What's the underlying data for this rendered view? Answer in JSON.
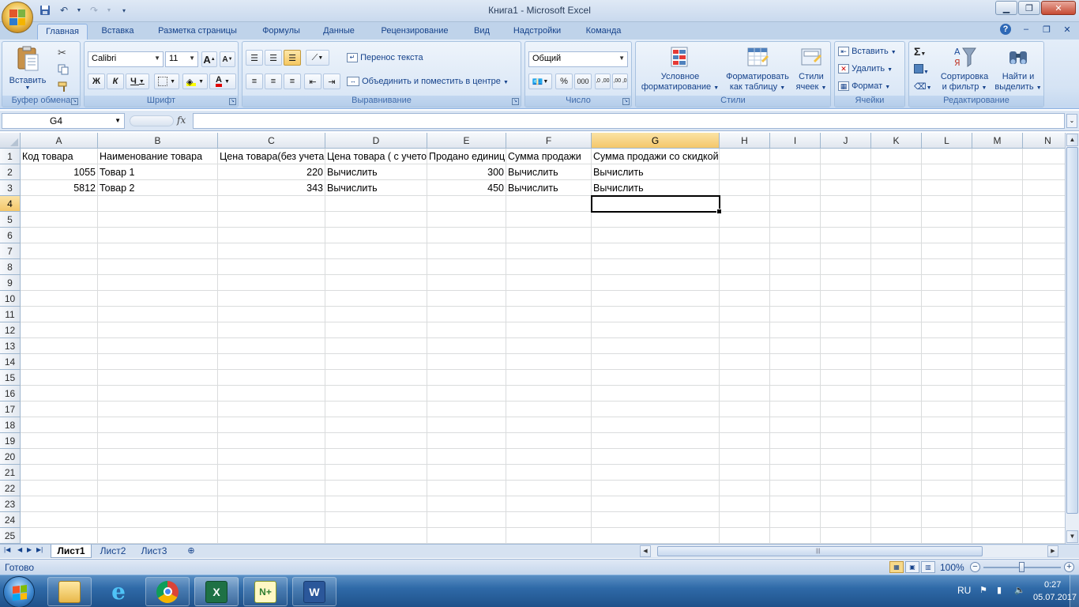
{
  "window": {
    "title": "Книга1 - Microsoft Excel"
  },
  "tabs": [
    "Главная",
    "Вставка",
    "Разметка страницы",
    "Формулы",
    "Данные",
    "Рецензирование",
    "Вид",
    "Надстройки",
    "Команда"
  ],
  "ribbon": {
    "clipboard": {
      "label": "Буфер обмена",
      "paste": "Вставить"
    },
    "font": {
      "label": "Шрифт",
      "name": "Calibri",
      "size": "11",
      "bold": "Ж",
      "italic": "К",
      "underline": "Ч",
      "grow": "A",
      "shrink": "A"
    },
    "alignment": {
      "label": "Выравнивание",
      "wrap": "Перенос текста",
      "merge": "Объединить и поместить в центре"
    },
    "number": {
      "label": "Число",
      "format": "Общий",
      "percent": "%",
      "thousands": "000",
      "inc_decimal": "‚0 ,00",
      "dec_decimal": ",00 ‚0"
    },
    "styles": {
      "label": "Стили",
      "conditional_1": "Условное",
      "conditional_2": "форматирование",
      "format_table_1": "Форматировать",
      "format_table_2": "как таблицу",
      "cell_styles_1": "Стили",
      "cell_styles_2": "ячеек"
    },
    "cells": {
      "label": "Ячейки",
      "insert": "Вставить",
      "delete": "Удалить",
      "format": "Формат"
    },
    "editing": {
      "label": "Редактирование",
      "sort_1": "Сортировка",
      "sort_2": "и фильтр",
      "find_1": "Найти и",
      "find_2": "выделить",
      "sigma": "Σ"
    }
  },
  "formula_bar": {
    "name_box": "G4",
    "fx": "fx",
    "content": ""
  },
  "grid": {
    "columns": [
      "A",
      "B",
      "C",
      "D",
      "E",
      "F",
      "G",
      "H",
      "I",
      "J",
      "K",
      "L",
      "M",
      "N"
    ],
    "rows": [
      "1",
      "2",
      "3",
      "4",
      "5",
      "6",
      "7",
      "8",
      "9",
      "10",
      "11",
      "12",
      "13",
      "14",
      "15",
      "16",
      "17",
      "18",
      "19",
      "20",
      "21",
      "22",
      "23",
      "24",
      "25"
    ],
    "selected_cell": "G4",
    "cells": {
      "A1": "Код товара",
      "B1": "Наименование товара",
      "C1": "Цена товара(без учета скидки)",
      "D1": "Цена товара ( с учетом скидки)",
      "E1": "Продано единиц",
      "F1": "Сумма продажи",
      "G1": "Сумма продажи со скидкой",
      "A2": "1055",
      "B2": "Товар 1",
      "C2": "220",
      "D2": "Вычислить",
      "E2": "300",
      "F2": "Вычислить",
      "G2": "Вычислить",
      "A3": "5812",
      "B3": "Товар 2",
      "C3": "343",
      "D3": "Вычислить",
      "E3": "450",
      "F3": "Вычислить",
      "G3": "Вычислить"
    }
  },
  "sheets": [
    "Лист1",
    "Лист2",
    "Лист3"
  ],
  "active_sheet": "Лист1",
  "status": {
    "text": "Готово",
    "zoom": "100%"
  },
  "taskbar": {
    "lang": "RU",
    "time": "0:27",
    "date": "05.07.2017",
    "apps": [
      "file-explorer",
      "internet-explorer",
      "chrome",
      "excel",
      "notepad-plus-plus",
      "word"
    ]
  }
}
